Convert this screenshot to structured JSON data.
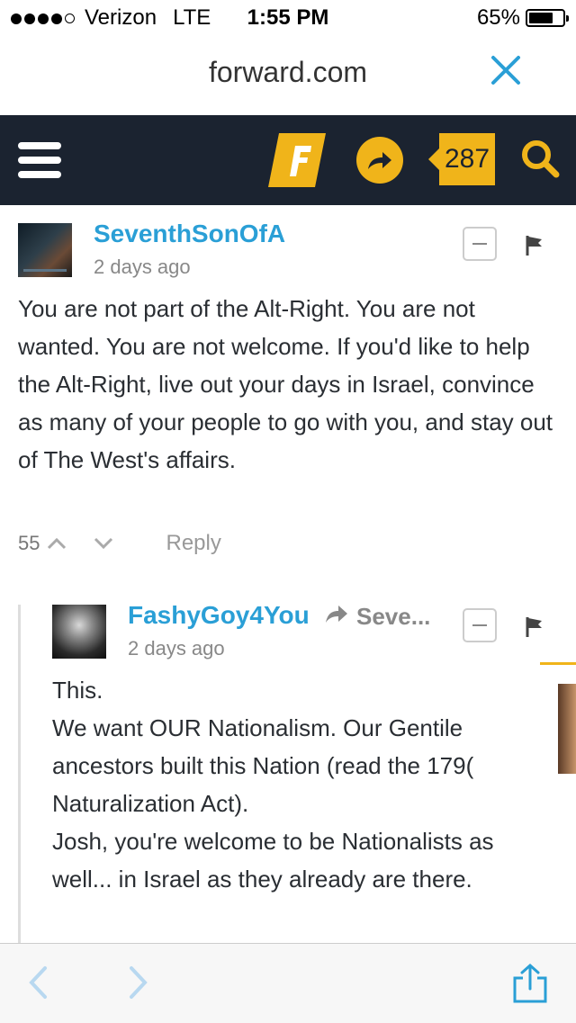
{
  "status_bar": {
    "carrier": "Verizon",
    "network": "LTE",
    "time": "1:55 PM",
    "battery": "65%",
    "battery_level": 0.65,
    "signal_bars_filled": 4,
    "signal_bars_total": 5
  },
  "browser": {
    "url": "forward.com"
  },
  "site_nav": {
    "comment_count": "287",
    "accent_color": "#f0b41a",
    "background_color": "#1b2330"
  },
  "comments": [
    {
      "author": "SeventhSonOfA",
      "time": "2 days ago",
      "body": "You are not part of the Alt-Right. You are not wanted. You are not welcome. If you'd like to help the Alt-Right, live out your days in Israel, convince as many of your people to go with you, and stay out of The West's affairs.",
      "votes": "55",
      "reply_label": "Reply"
    },
    {
      "author": "FashyGoy4You",
      "reply_to": "Seve...",
      "time": "2 days ago",
      "body_lines": [
        "This.",
        "We want OUR Nationalism. Our Gentile ancestors built this Nation (read the 179(",
        "Naturalization Act).",
        "Josh, you're welcome to be Nationalists as well... in Israel as they already are there."
      ]
    }
  ],
  "colors": {
    "author_link": "#2a9fd6",
    "ios_blue": "#2a9fd6"
  },
  "icons": {
    "menu": "hamburger-icon",
    "logo": "forward-logo",
    "share": "share-arrow-icon",
    "search": "search-icon",
    "close": "close-icon",
    "flag": "flag-icon",
    "back": "chevron-left-icon",
    "forward": "chevron-right-icon",
    "ios_share": "share-upload-icon"
  }
}
